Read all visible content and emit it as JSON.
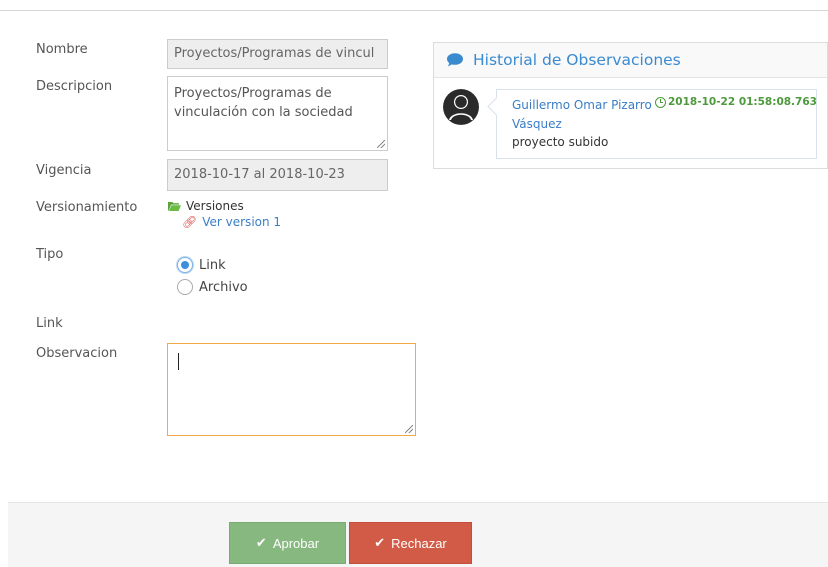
{
  "form": {
    "nombre_label": "Nombre",
    "nombre_value": "Proyectos/Programas de vincul",
    "descripcion_label": "Descripcion",
    "descripcion_value": "Proyectos/Programas de vinculación con la sociedad",
    "vigencia_label": "Vigencia",
    "vigencia_value": "2018-10-17 al 2018-10-23",
    "versionamiento_label": "Versionamiento",
    "versiones_label": "Versiones",
    "ver_version_label": "Ver version 1",
    "tipo_label": "Tipo",
    "tipo_options": [
      {
        "label": "Link",
        "checked": true
      },
      {
        "label": "Archivo",
        "checked": false
      }
    ],
    "link_label": "Link",
    "observacion_label": "Observacion",
    "observacion_value": ""
  },
  "history": {
    "title": "Historial de Observaciones",
    "entries": [
      {
        "author": "Guillermo Omar Pizarro Vásquez",
        "timestamp": "2018-10-22 01:58:08.763",
        "message": "proyecto subido"
      }
    ]
  },
  "actions": {
    "approve_label": "Aprobar",
    "reject_label": "Rechazar"
  },
  "colors": {
    "accent_blue": "#3a8ad0",
    "approve_green": "#87b87f",
    "reject_red": "#d15b47",
    "timestamp_green": "#4c9a3b",
    "focus_orange": "#f0a84a"
  },
  "icons": {
    "panel_icon": "comment-icon",
    "versions_icon": "folder-open-icon",
    "version_link_icon": "link-icon",
    "timestamp_icon": "clock-icon",
    "button_icon": "check-icon"
  }
}
